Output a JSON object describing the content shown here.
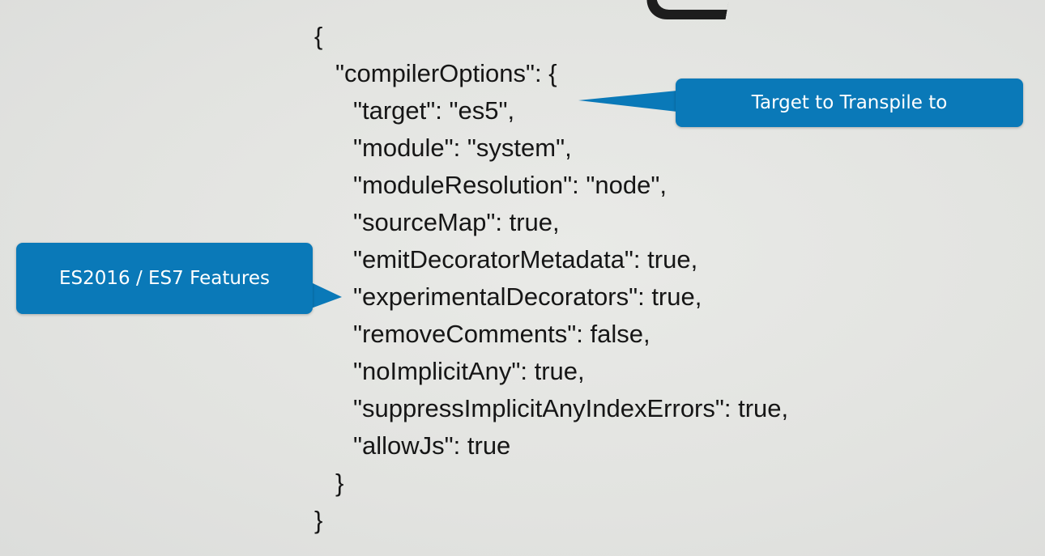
{
  "code": {
    "lines": [
      {
        "text": "{",
        "indent": 0
      },
      {
        "text": "\"compilerOptions\": {",
        "indent": 1
      },
      {
        "text": "\"target\": \"es5\",",
        "indent": 2
      },
      {
        "text": "\"module\": \"system\",",
        "indent": 2
      },
      {
        "text": "\"moduleResolution\": \"node\",",
        "indent": 2
      },
      {
        "text": "\"sourceMap\": true,",
        "indent": 2
      },
      {
        "text": "\"emitDecoratorMetadata\": true,",
        "indent": 2
      },
      {
        "text": "\"experimentalDecorators\": true,",
        "indent": 2
      },
      {
        "text": "\"removeComments\": false,",
        "indent": 2
      },
      {
        "text": "\"noImplicitAny\": true,",
        "indent": 2
      },
      {
        "text": "\"suppressImplicitAnyIndexErrors\": true,",
        "indent": 2
      },
      {
        "text": "\"allowJs\": true",
        "indent": 2
      },
      {
        "text": "}",
        "indent": 1
      },
      {
        "text": "}",
        "indent": 0
      }
    ]
  },
  "callouts": {
    "target_label": "Target to Transpile to",
    "es7_label": "ES2016 / ES7 Features"
  },
  "colors": {
    "background": "#e3e4e1",
    "callout": "#0a79b8",
    "code_text": "#161616"
  }
}
